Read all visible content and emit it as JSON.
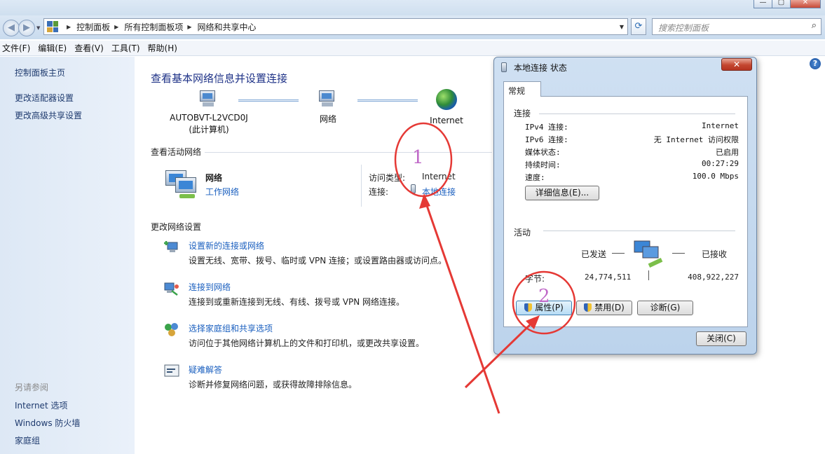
{
  "window": {
    "controls": {
      "minimize": "—",
      "maximize": "▢",
      "close": "✕"
    }
  },
  "address": {
    "crumbs": [
      "控制面板",
      "所有控制面板项",
      "网络和共享中心"
    ],
    "search_placeholder": "搜索控制面板"
  },
  "menubar": [
    "文件(F)",
    "编辑(E)",
    "查看(V)",
    "工具(T)",
    "帮助(H)"
  ],
  "leftnav": {
    "links": [
      "控制面板主页",
      "更改适配器设置",
      "更改高级共享设置"
    ],
    "see_also_title": "另请参阅",
    "see_also": [
      "Internet 选项",
      "Windows 防火墙",
      "家庭组"
    ]
  },
  "main": {
    "title": "查看基本网络信息并设置连接",
    "map": {
      "computer_name": "AUTOBVT-L2VCD0J",
      "computer_sub": "(此计算机)",
      "network": "网络",
      "internet": "Internet"
    },
    "active_header": "查看活动网络",
    "active": {
      "name": "网络",
      "type_link": "工作网络",
      "access_label": "访问类型:",
      "access_value": "Internet",
      "conn_label": "连接:",
      "conn_link": "本地连接"
    },
    "change_header": "更改网络设置",
    "tasks": [
      {
        "title": "设置新的连接或网络",
        "desc": "设置无线、宽带、拨号、临时或 VPN 连接；或设置路由器或访问点。"
      },
      {
        "title": "连接到网络",
        "desc": "连接到或重新连接到无线、有线、拨号或 VPN 网络连接。"
      },
      {
        "title": "选择家庭组和共享选项",
        "desc": "访问位于其他网络计算机上的文件和打印机，或更改共享设置。"
      },
      {
        "title": "疑难解答",
        "desc": "诊断并修复网络问题，或获得故障排除信息。"
      }
    ]
  },
  "dialog": {
    "title": "本地连接 状态",
    "tab": "常规",
    "conn_header": "连接",
    "rows": [
      {
        "k": "IPv4 连接:",
        "v": "Internet"
      },
      {
        "k": "IPv6 连接:",
        "v": "无 Internet 访问权限"
      },
      {
        "k": "媒体状态:",
        "v": "已启用"
      },
      {
        "k": "持续时间:",
        "v": "00:27:29"
      },
      {
        "k": "速度:",
        "v": "100.0 Mbps"
      }
    ],
    "details_btn": "详细信息(E)...",
    "activity_header": "活动",
    "sent_label": "已发送",
    "recv_label": "已接收",
    "bytes_label": "字节:",
    "bytes_sent": "24,774,511",
    "bytes_recv": "408,922,227",
    "properties_btn": "属性(P)",
    "disable_btn": "禁用(D)",
    "diagnose_btn": "诊断(G)",
    "close_btn": "关闭(C)"
  },
  "annotations": {
    "mark1": "1",
    "mark2": "2",
    "color": "#e53935"
  }
}
